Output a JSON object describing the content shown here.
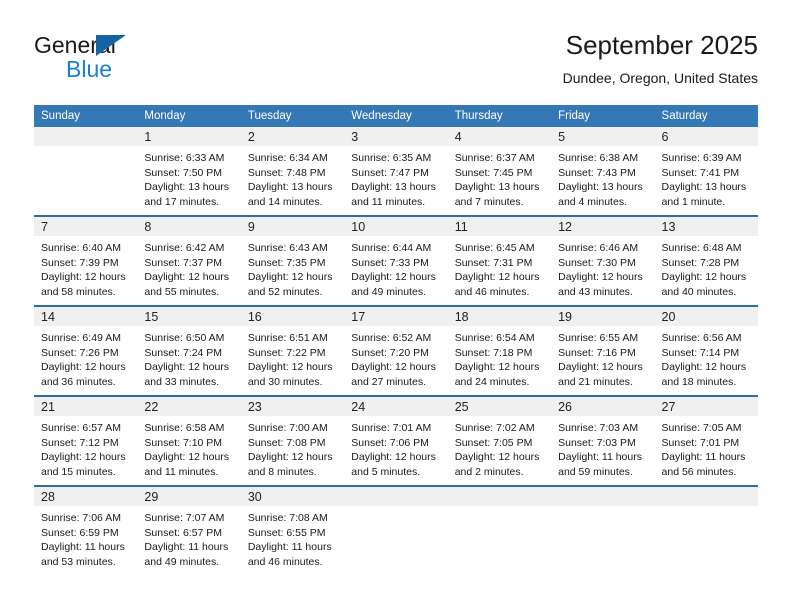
{
  "brand": {
    "name_part1": "General",
    "name_part2": "Blue",
    "accent_color": "#1a7fd4",
    "triangle_color": "#1464a5"
  },
  "header": {
    "title": "September 2025",
    "location": "Dundee, Oregon, United States"
  },
  "theme": {
    "header_row_bg": "#3478b5",
    "row_divider": "#2e6da4",
    "daynum_band_bg": "#f0f0f0",
    "text": "#1a1a1a"
  },
  "weekday_headers": [
    "Sunday",
    "Monday",
    "Tuesday",
    "Wednesday",
    "Thursday",
    "Friday",
    "Saturday"
  ],
  "weeks": [
    [
      {
        "day": "",
        "sunrise": "",
        "sunset": "",
        "daylight_line1": "",
        "daylight_line2": "",
        "empty": true
      },
      {
        "day": "1",
        "sunrise": "Sunrise: 6:33 AM",
        "sunset": "Sunset: 7:50 PM",
        "daylight_line1": "Daylight: 13 hours",
        "daylight_line2": "and 17 minutes.",
        "empty": false
      },
      {
        "day": "2",
        "sunrise": "Sunrise: 6:34 AM",
        "sunset": "Sunset: 7:48 PM",
        "daylight_line1": "Daylight: 13 hours",
        "daylight_line2": "and 14 minutes.",
        "empty": false
      },
      {
        "day": "3",
        "sunrise": "Sunrise: 6:35 AM",
        "sunset": "Sunset: 7:47 PM",
        "daylight_line1": "Daylight: 13 hours",
        "daylight_line2": "and 11 minutes.",
        "empty": false
      },
      {
        "day": "4",
        "sunrise": "Sunrise: 6:37 AM",
        "sunset": "Sunset: 7:45 PM",
        "daylight_line1": "Daylight: 13 hours",
        "daylight_line2": "and 7 minutes.",
        "empty": false
      },
      {
        "day": "5",
        "sunrise": "Sunrise: 6:38 AM",
        "sunset": "Sunset: 7:43 PM",
        "daylight_line1": "Daylight: 13 hours",
        "daylight_line2": "and 4 minutes.",
        "empty": false
      },
      {
        "day": "6",
        "sunrise": "Sunrise: 6:39 AM",
        "sunset": "Sunset: 7:41 PM",
        "daylight_line1": "Daylight: 13 hours",
        "daylight_line2": "and 1 minute.",
        "empty": false
      }
    ],
    [
      {
        "day": "7",
        "sunrise": "Sunrise: 6:40 AM",
        "sunset": "Sunset: 7:39 PM",
        "daylight_line1": "Daylight: 12 hours",
        "daylight_line2": "and 58 minutes.",
        "empty": false
      },
      {
        "day": "8",
        "sunrise": "Sunrise: 6:42 AM",
        "sunset": "Sunset: 7:37 PM",
        "daylight_line1": "Daylight: 12 hours",
        "daylight_line2": "and 55 minutes.",
        "empty": false
      },
      {
        "day": "9",
        "sunrise": "Sunrise: 6:43 AM",
        "sunset": "Sunset: 7:35 PM",
        "daylight_line1": "Daylight: 12 hours",
        "daylight_line2": "and 52 minutes.",
        "empty": false
      },
      {
        "day": "10",
        "sunrise": "Sunrise: 6:44 AM",
        "sunset": "Sunset: 7:33 PM",
        "daylight_line1": "Daylight: 12 hours",
        "daylight_line2": "and 49 minutes.",
        "empty": false
      },
      {
        "day": "11",
        "sunrise": "Sunrise: 6:45 AM",
        "sunset": "Sunset: 7:31 PM",
        "daylight_line1": "Daylight: 12 hours",
        "daylight_line2": "and 46 minutes.",
        "empty": false
      },
      {
        "day": "12",
        "sunrise": "Sunrise: 6:46 AM",
        "sunset": "Sunset: 7:30 PM",
        "daylight_line1": "Daylight: 12 hours",
        "daylight_line2": "and 43 minutes.",
        "empty": false
      },
      {
        "day": "13",
        "sunrise": "Sunrise: 6:48 AM",
        "sunset": "Sunset: 7:28 PM",
        "daylight_line1": "Daylight: 12 hours",
        "daylight_line2": "and 40 minutes.",
        "empty": false
      }
    ],
    [
      {
        "day": "14",
        "sunrise": "Sunrise: 6:49 AM",
        "sunset": "Sunset: 7:26 PM",
        "daylight_line1": "Daylight: 12 hours",
        "daylight_line2": "and 36 minutes.",
        "empty": false
      },
      {
        "day": "15",
        "sunrise": "Sunrise: 6:50 AM",
        "sunset": "Sunset: 7:24 PM",
        "daylight_line1": "Daylight: 12 hours",
        "daylight_line2": "and 33 minutes.",
        "empty": false
      },
      {
        "day": "16",
        "sunrise": "Sunrise: 6:51 AM",
        "sunset": "Sunset: 7:22 PM",
        "daylight_line1": "Daylight: 12 hours",
        "daylight_line2": "and 30 minutes.",
        "empty": false
      },
      {
        "day": "17",
        "sunrise": "Sunrise: 6:52 AM",
        "sunset": "Sunset: 7:20 PM",
        "daylight_line1": "Daylight: 12 hours",
        "daylight_line2": "and 27 minutes.",
        "empty": false
      },
      {
        "day": "18",
        "sunrise": "Sunrise: 6:54 AM",
        "sunset": "Sunset: 7:18 PM",
        "daylight_line1": "Daylight: 12 hours",
        "daylight_line2": "and 24 minutes.",
        "empty": false
      },
      {
        "day": "19",
        "sunrise": "Sunrise: 6:55 AM",
        "sunset": "Sunset: 7:16 PM",
        "daylight_line1": "Daylight: 12 hours",
        "daylight_line2": "and 21 minutes.",
        "empty": false
      },
      {
        "day": "20",
        "sunrise": "Sunrise: 6:56 AM",
        "sunset": "Sunset: 7:14 PM",
        "daylight_line1": "Daylight: 12 hours",
        "daylight_line2": "and 18 minutes.",
        "empty": false
      }
    ],
    [
      {
        "day": "21",
        "sunrise": "Sunrise: 6:57 AM",
        "sunset": "Sunset: 7:12 PM",
        "daylight_line1": "Daylight: 12 hours",
        "daylight_line2": "and 15 minutes.",
        "empty": false
      },
      {
        "day": "22",
        "sunrise": "Sunrise: 6:58 AM",
        "sunset": "Sunset: 7:10 PM",
        "daylight_line1": "Daylight: 12 hours",
        "daylight_line2": "and 11 minutes.",
        "empty": false
      },
      {
        "day": "23",
        "sunrise": "Sunrise: 7:00 AM",
        "sunset": "Sunset: 7:08 PM",
        "daylight_line1": "Daylight: 12 hours",
        "daylight_line2": "and 8 minutes.",
        "empty": false
      },
      {
        "day": "24",
        "sunrise": "Sunrise: 7:01 AM",
        "sunset": "Sunset: 7:06 PM",
        "daylight_line1": "Daylight: 12 hours",
        "daylight_line2": "and 5 minutes.",
        "empty": false
      },
      {
        "day": "25",
        "sunrise": "Sunrise: 7:02 AM",
        "sunset": "Sunset: 7:05 PM",
        "daylight_line1": "Daylight: 12 hours",
        "daylight_line2": "and 2 minutes.",
        "empty": false
      },
      {
        "day": "26",
        "sunrise": "Sunrise: 7:03 AM",
        "sunset": "Sunset: 7:03 PM",
        "daylight_line1": "Daylight: 11 hours",
        "daylight_line2": "and 59 minutes.",
        "empty": false
      },
      {
        "day": "27",
        "sunrise": "Sunrise: 7:05 AM",
        "sunset": "Sunset: 7:01 PM",
        "daylight_line1": "Daylight: 11 hours",
        "daylight_line2": "and 56 minutes.",
        "empty": false
      }
    ],
    [
      {
        "day": "28",
        "sunrise": "Sunrise: 7:06 AM",
        "sunset": "Sunset: 6:59 PM",
        "daylight_line1": "Daylight: 11 hours",
        "daylight_line2": "and 53 minutes.",
        "empty": false
      },
      {
        "day": "29",
        "sunrise": "Sunrise: 7:07 AM",
        "sunset": "Sunset: 6:57 PM",
        "daylight_line1": "Daylight: 11 hours",
        "daylight_line2": "and 49 minutes.",
        "empty": false
      },
      {
        "day": "30",
        "sunrise": "Sunrise: 7:08 AM",
        "sunset": "Sunset: 6:55 PM",
        "daylight_line1": "Daylight: 11 hours",
        "daylight_line2": "and 46 minutes.",
        "empty": false
      },
      {
        "day": "",
        "sunrise": "",
        "sunset": "",
        "daylight_line1": "",
        "daylight_line2": "",
        "empty": true
      },
      {
        "day": "",
        "sunrise": "",
        "sunset": "",
        "daylight_line1": "",
        "daylight_line2": "",
        "empty": true
      },
      {
        "day": "",
        "sunrise": "",
        "sunset": "",
        "daylight_line1": "",
        "daylight_line2": "",
        "empty": true
      },
      {
        "day": "",
        "sunrise": "",
        "sunset": "",
        "daylight_line1": "",
        "daylight_line2": "",
        "empty": true
      }
    ]
  ]
}
